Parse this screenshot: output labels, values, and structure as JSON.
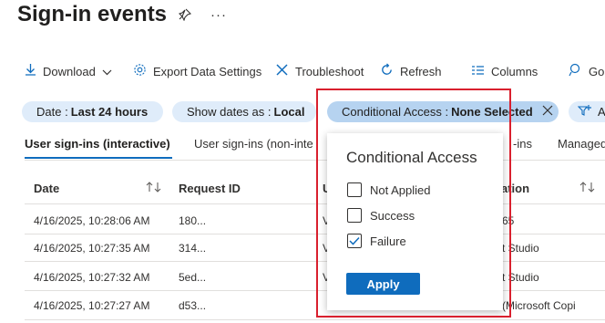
{
  "page": {
    "title": "Sign-in events"
  },
  "toolbar": {
    "download": "Download",
    "export": "Export Data Settings",
    "troubleshoot": "Troubleshoot",
    "refresh": "Refresh",
    "columns": "Columns",
    "got": "Go"
  },
  "filters": {
    "date_label": "Date :",
    "date_value": "Last 24 hours",
    "show_dates_label": "Show dates as :",
    "show_dates_value": "Local",
    "ca_label": "Conditional Access :",
    "ca_value": "None Selected",
    "add_label": "A"
  },
  "tabs": {
    "interactive": "User sign-ins (interactive)",
    "noninteractive": "User sign-ins (non-inte",
    "third_partial": "-ins",
    "managed": "Managed"
  },
  "table": {
    "headers": {
      "date": "Date",
      "request_id": "Request ID",
      "user_partial": "U",
      "application_partial": "ation"
    },
    "rows": [
      {
        "date": "4/16/2025, 10:28:06 AM",
        "request_id": "180...",
        "user_partial": "V",
        "app_partial": "65"
      },
      {
        "date": "4/16/2025, 10:27:35 AM",
        "request_id": "314...",
        "user_partial": "V",
        "app_partial": "t Studio"
      },
      {
        "date": "4/16/2025, 10:27:32 AM",
        "request_id": "5ed...",
        "user_partial": "V",
        "app_partial": "t Studio"
      },
      {
        "date": "4/16/2025, 10:27:27 AM",
        "request_id": "d53...",
        "user_partial": "",
        "app_partial": "1 (Microsoft Copi"
      }
    ]
  },
  "popup": {
    "title": "Conditional Access",
    "options": [
      {
        "label": "Not Applied",
        "checked": false
      },
      {
        "label": "Success",
        "checked": false
      },
      {
        "label": "Failure",
        "checked": true
      }
    ],
    "apply": "Apply"
  },
  "colors": {
    "accent": "#0f6cbd",
    "highlight": "#d9202e",
    "pill": "#dfecfa"
  }
}
